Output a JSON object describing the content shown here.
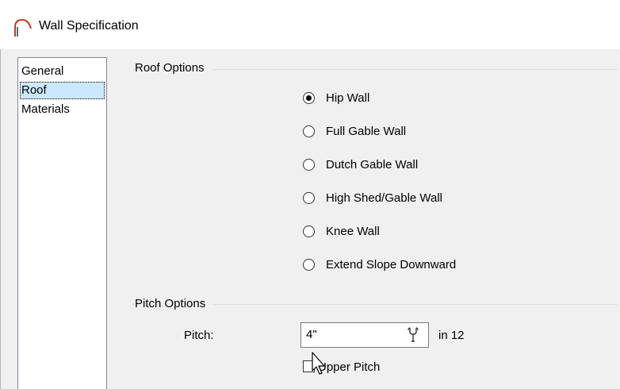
{
  "window": {
    "title": "Wall Specification",
    "icon": "arch-wall-icon"
  },
  "nav": {
    "items": [
      {
        "label": "General",
        "selected": false
      },
      {
        "label": "Roof",
        "selected": true
      },
      {
        "label": "Materials",
        "selected": false
      }
    ]
  },
  "roof_options": {
    "title": "Roof Options",
    "radios": [
      {
        "label": "Hip Wall",
        "checked": true
      },
      {
        "label": "Full Gable Wall",
        "checked": false
      },
      {
        "label": "Dutch Gable Wall",
        "checked": false
      },
      {
        "label": "High Shed/Gable Wall",
        "checked": false
      },
      {
        "label": "Knee Wall",
        "checked": false
      },
      {
        "label": "Extend Slope Downward",
        "checked": false
      }
    ]
  },
  "pitch_options": {
    "title": "Pitch Options",
    "pitch_label": "Pitch:",
    "pitch_value": "4\"",
    "pitch_units": "in 12",
    "wrench_icon": "wrench-icon",
    "upper_pitch_label": "Upper Pitch",
    "upper_pitch_checked": false
  },
  "colors": {
    "dialog_bg": "#f0f0f0",
    "selection": "#cce8ff",
    "title_icon": "#c0392b"
  }
}
